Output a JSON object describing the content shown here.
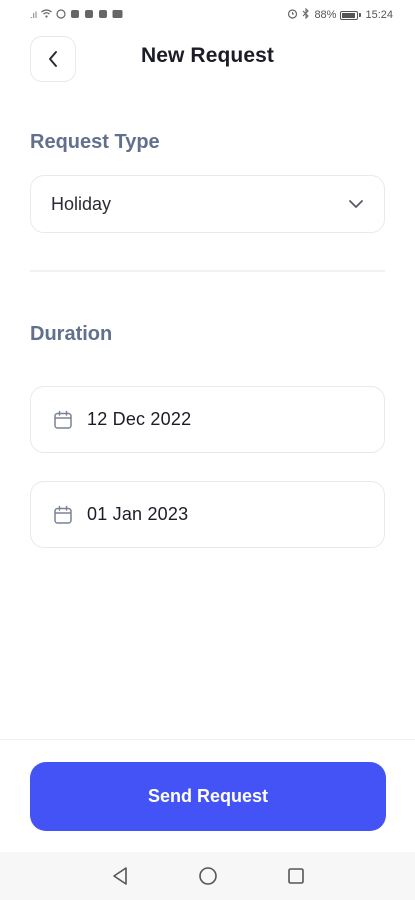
{
  "status_bar": {
    "signal_text": ".ıl",
    "battery_text": "88%",
    "battery_level": 0.88,
    "time": "15:24"
  },
  "header": {
    "back_icon": "chevron-left-icon",
    "title": "New Request"
  },
  "request_type": {
    "label": "Request Type",
    "selected_value": "Holiday",
    "dropdown_icon": "chevron-down-icon"
  },
  "duration": {
    "label": "Duration",
    "start_date": "12 Dec 2022",
    "end_date": "01 Jan 2023",
    "date_icon": "calendar-icon"
  },
  "actions": {
    "send_label": "Send Request"
  },
  "colors": {
    "accent": "#4353f5",
    "label": "#61708c",
    "border": "#e7e9ee"
  },
  "nav": {
    "back_icon": "triangle-back-icon",
    "home_icon": "circle-home-icon",
    "recents_icon": "square-recents-icon"
  }
}
